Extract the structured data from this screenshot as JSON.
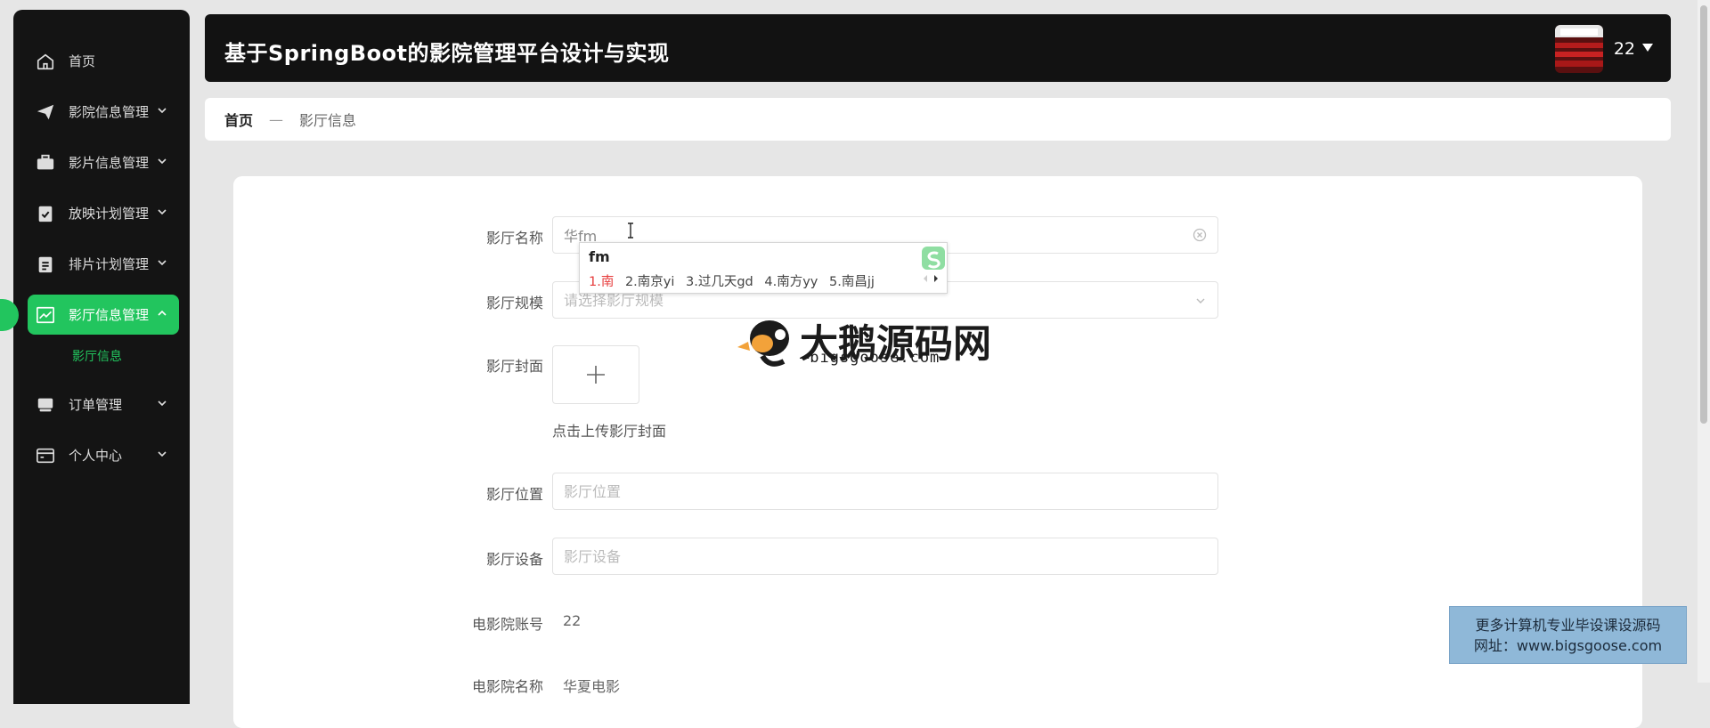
{
  "watermark_top": "大鹅源码网:www.bigsgoose.com",
  "header": {
    "title": "基于SpringBoot的影院管理平台设计与实现",
    "user_name": "22"
  },
  "sidebar": {
    "items": [
      {
        "label": "首页",
        "icon": "home-icon"
      },
      {
        "label": "影院信息管理",
        "icon": "paper-plane-icon"
      },
      {
        "label": "影片信息管理",
        "icon": "briefcase-icon"
      },
      {
        "label": "放映计划管理",
        "icon": "clipboard-check-icon"
      },
      {
        "label": "排片计划管理",
        "icon": "clipboard-list-icon"
      },
      {
        "label": "影厅信息管理",
        "icon": "line-chart-icon",
        "active": true
      },
      {
        "label": "订单管理",
        "icon": "monitor-icon"
      },
      {
        "label": "个人中心",
        "icon": "wallet-icon"
      }
    ],
    "submenu": {
      "label": "影厅信息"
    }
  },
  "breadcrumb": {
    "home": "首页",
    "separator": "—",
    "current": "影厅信息"
  },
  "form": {
    "hall_name": {
      "label": "影厅名称",
      "value": "华fm"
    },
    "hall_scale": {
      "label": "影厅规模",
      "placeholder": "请选择影厅规模"
    },
    "hall_cover": {
      "label": "影厅封面",
      "hint": "点击上传影厅封面"
    },
    "hall_location": {
      "label": "影厅位置",
      "placeholder": "影厅位置"
    },
    "hall_equipment": {
      "label": "影厅设备",
      "placeholder": "影厅设备"
    },
    "cinema_account": {
      "label": "电影院账号",
      "value": "22"
    },
    "cinema_name": {
      "label": "电影院名称",
      "value": "华夏电影"
    }
  },
  "ime": {
    "composition": "fm",
    "candidates": [
      "1.南",
      "2.南京yi",
      "3.过几天gd",
      "4.南方yy",
      "5.南昌jj"
    ]
  },
  "center_logo": {
    "title": "大鹅源码网",
    "subtitle": "—bigsgoose.com—"
  },
  "ad": {
    "line1": "更多计算机专业毕设课设源码",
    "line2": "网址：www.bigsgoose.com"
  },
  "colors": {
    "accent": "#22c55e",
    "sidebar_bg": "#141414",
    "header_bg": "#121212",
    "watermark_red": "#e60000"
  }
}
